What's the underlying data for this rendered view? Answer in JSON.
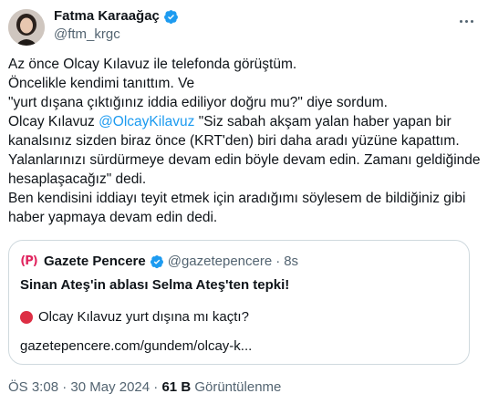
{
  "author": {
    "name": "Fatma Karaağaç",
    "handle": "@ftm_krgc",
    "avatar_icon": "profile-photo",
    "verified_color": "#1d9bf0"
  },
  "tweet": {
    "line1": "Az önce Olcay Kılavuz ile telefonda görüştüm.",
    "line2": "Öncelikle kendimi tanıttım. Ve",
    "line3": "\"yurt dışana çıktığınız iddia ediliyor doğru mu?\" diye sordum.",
    "line4_prefix": "Olcay Kılavuz ",
    "mention": "@OlcayKilavuz",
    "line4_suffix": " \"Siz sabah akşam yalan haber yapan bir kanalsınız sizden biraz önce (KRT'den) biri daha aradı yüzüne kapattım. Yalanlarınızı sürdürmeye devam edin böyle devam edin. Zamanı geldiğinde hesaplaşacağız\" dedi.",
    "line5": "Ben kendisini iddiayı teyit etmek için aradığımı söylesem de bildiğiniz gibi haber yapmaya devam edin dedi."
  },
  "quote": {
    "logo_text": "(P)",
    "name": "Gazete Pencere",
    "handle": "@gazetepencere",
    "separator": "·",
    "time": "8s",
    "title": "Sinan Ateş'in ablası Selma Ateş'ten tepki!",
    "line": "Olcay Kılavuz yurt dışına mı kaçtı?",
    "link": "gazetepencere.com/gundem/olcay-k..."
  },
  "footer": {
    "time": "ÖS 3:08",
    "sep1": "·",
    "date": "30 May 2024",
    "sep2": "·",
    "views": "61 B",
    "views_label": "Görüntülenme"
  },
  "colors": {
    "accent": "#1d9bf0",
    "muted": "#536471",
    "text": "#0f1419",
    "border": "#cfd9de",
    "logo_red": "#e0245e",
    "dot_red": "#dd2e44"
  }
}
